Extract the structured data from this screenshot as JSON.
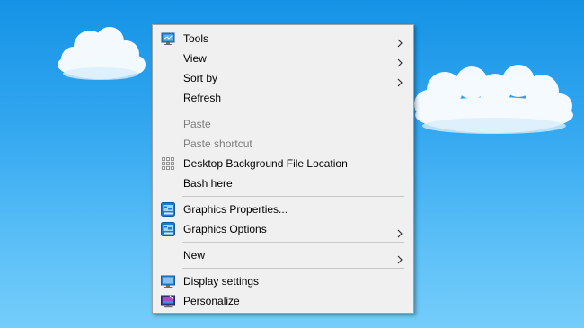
{
  "desktop": {
    "background_top": "#1593e6",
    "background_bottom": "#75cdfa"
  },
  "context_menu": {
    "group1": {
      "tools": {
        "label": "Tools",
        "icon": "monitor-icon",
        "has_submenu": true
      },
      "view": {
        "label": "View",
        "has_submenu": true
      },
      "sort_by": {
        "label": "Sort by",
        "has_submenu": true
      },
      "refresh": {
        "label": "Refresh"
      }
    },
    "group2": {
      "paste": {
        "label": "Paste",
        "disabled": true
      },
      "paste_shortcut": {
        "label": "Paste shortcut",
        "disabled": true
      },
      "desktop_background": {
        "label": "Desktop Background File Location",
        "icon": "grid-icon"
      },
      "bash_here": {
        "label": "Bash here"
      }
    },
    "group3": {
      "graphics_properties": {
        "label": "Graphics Properties...",
        "icon": "intel-graphics-icon"
      },
      "graphics_options": {
        "label": "Graphics Options",
        "icon": "intel-graphics-icon",
        "has_submenu": true
      }
    },
    "group4": {
      "new": {
        "label": "New",
        "has_submenu": true
      }
    },
    "group5": {
      "display_settings": {
        "label": "Display settings",
        "icon": "display-icon"
      },
      "personalize": {
        "label": "Personalize",
        "icon": "personalize-icon"
      }
    }
  }
}
